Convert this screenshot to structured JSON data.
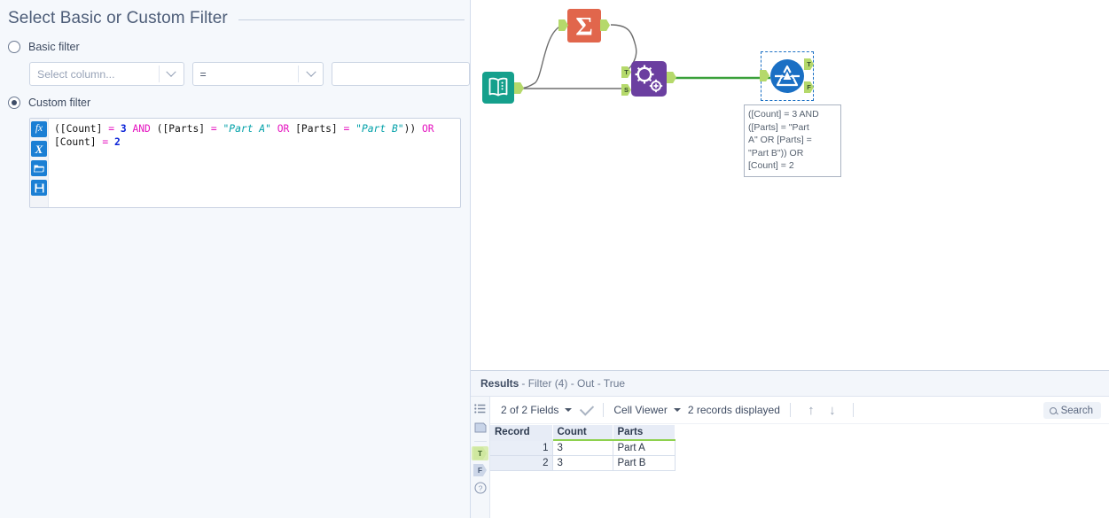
{
  "config_panel": {
    "title": "Select Basic or Custom Filter",
    "basic_filter": {
      "label": "Basic filter",
      "selected": false,
      "column_placeholder": "Select column...",
      "operator_value": "=",
      "value_text": ""
    },
    "custom_filter": {
      "label": "Custom filter",
      "selected": true,
      "gutter_buttons": [
        {
          "name": "function-icon",
          "glyph": "fx"
        },
        {
          "name": "variable-icon",
          "glyph": "X"
        },
        {
          "name": "open-folder-icon",
          "glyph": "▰"
        },
        {
          "name": "save-disk-icon",
          "glyph": "▣"
        }
      ],
      "expression_plain": "([Count] = 3 AND ([Parts] = \"Part A\" OR [Parts] = \"Part B\")) OR [Count] = 2",
      "expression_tokens": [
        {
          "t": "([Count] ",
          "k": "pln"
        },
        {
          "t": "= ",
          "k": "op"
        },
        {
          "t": "3 ",
          "k": "num"
        },
        {
          "t": "AND ",
          "k": "kw"
        },
        {
          "t": "([Parts] ",
          "k": "pln"
        },
        {
          "t": "= ",
          "k": "op"
        },
        {
          "t": "\"Part A\" ",
          "k": "str"
        },
        {
          "t": "OR ",
          "k": "kw"
        },
        {
          "t": "[Parts] ",
          "k": "pln"
        },
        {
          "t": "= ",
          "k": "op"
        },
        {
          "t": "\"Part B\"",
          "k": "str"
        },
        {
          "t": ")) ",
          "k": "pln"
        },
        {
          "t": "OR",
          "k": "kw"
        },
        {
          "t": " [Count] ",
          "k": "pln"
        },
        {
          "t": "= ",
          "k": "op"
        },
        {
          "t": "2",
          "k": "num"
        }
      ]
    }
  },
  "canvas": {
    "tools": [
      {
        "name": "input-data-tool",
        "label": "",
        "color": "#15a08c",
        "ports_out": [
          ""
        ]
      },
      {
        "name": "summarize-tool",
        "label": "Σ",
        "color": "#e1664c",
        "ports_in": [
          ""
        ],
        "ports_out": [
          ""
        ]
      },
      {
        "name": "join-tool",
        "label": "",
        "color": "#6b3fa0",
        "ports_in": [
          "T",
          "S"
        ],
        "ports_out": [
          ""
        ]
      },
      {
        "name": "filter-tool",
        "label": "",
        "color": "#1a6fc4",
        "ports_in": [
          ""
        ],
        "ports_out": [
          "T",
          "F"
        ],
        "selected": true
      }
    ],
    "annotation": "([Count] = 3 AND ([Parts] = \"Part A\" OR [Parts] = \"Part B\")) OR [Count] = 2",
    "annotation_lines": [
      "([Count] = 3 AND",
      "([Parts] = \"Part",
      "A\" OR [Parts] =",
      "\"Part B\")) OR",
      "[Count] = 2"
    ],
    "connection_color": "#3aa03a"
  },
  "results": {
    "header_bold": "Results",
    "header_rest": "- Filter (4) - Out - True",
    "rail_icons": [
      {
        "name": "list-view-icon",
        "glyph": "≡"
      },
      {
        "name": "metadata-icon",
        "glyph": "▭"
      },
      {
        "name": "true-output-icon",
        "glyph": "T",
        "active": true
      },
      {
        "name": "false-output-icon",
        "glyph": "F",
        "active": false
      },
      {
        "name": "help-icon",
        "glyph": "?"
      }
    ],
    "toolbar": {
      "fields_label": "2 of 2 Fields",
      "view_mode": "Cell Viewer",
      "records_label": "2 records displayed",
      "up_arrow": "↑",
      "down_arrow": "↓",
      "search_placeholder": "Search"
    },
    "grid": {
      "columns": [
        "Record",
        "Count",
        "Parts"
      ],
      "rows": [
        {
          "record": "1",
          "count": "3",
          "parts": "Part A"
        },
        {
          "record": "2",
          "count": "3",
          "parts": "Part B"
        }
      ]
    }
  }
}
